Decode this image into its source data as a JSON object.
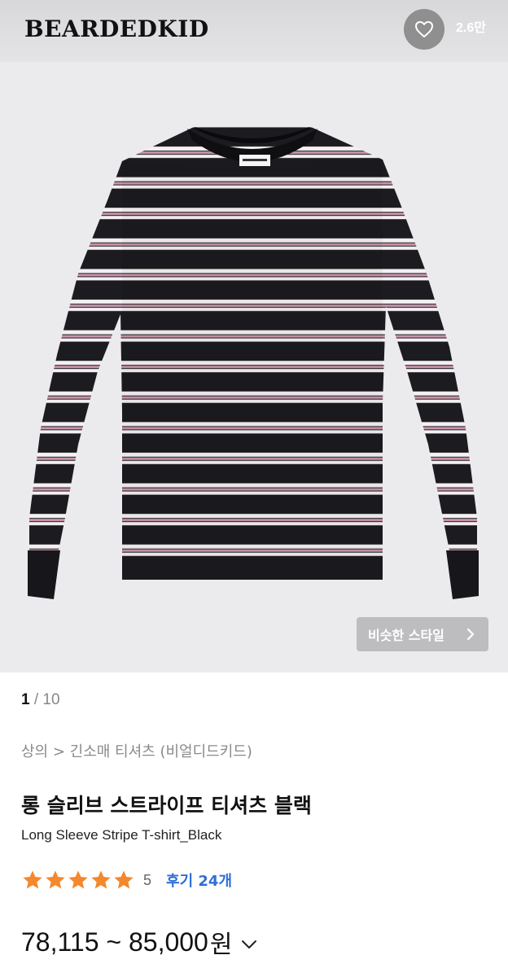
{
  "header": {
    "brand": "BEARDEDKID",
    "like_count": "2.6만"
  },
  "gallery": {
    "similar_style_label": "비슷한 스타일",
    "current_index": "1",
    "separator": "/",
    "total": "10"
  },
  "product": {
    "breadcrumb": "상의 > 긴소매 티셔츠 (비얼디드키드)",
    "title_ko": "롱 슬리브 스트라이프 티셔츠 블랙",
    "title_en": "Long Sleeve Stripe T-shirt_Black",
    "rating_value": "5",
    "rating_stars": 5,
    "review_label": "후기 24개",
    "price_range": "78,115 ~ 85,000",
    "price_unit": "원"
  },
  "icons": {
    "like": "heart-outline-icon",
    "similar_chevron": "chevron-right-icon",
    "star": "star-icon",
    "price_toggle": "chevron-down-icon"
  },
  "colors": {
    "star": "#f4882c",
    "review_link": "#2f6fd6",
    "shirt_base": "#1c1c20",
    "stripe_white": "#f4f0f2",
    "stripe_pink": "#c995a8"
  }
}
